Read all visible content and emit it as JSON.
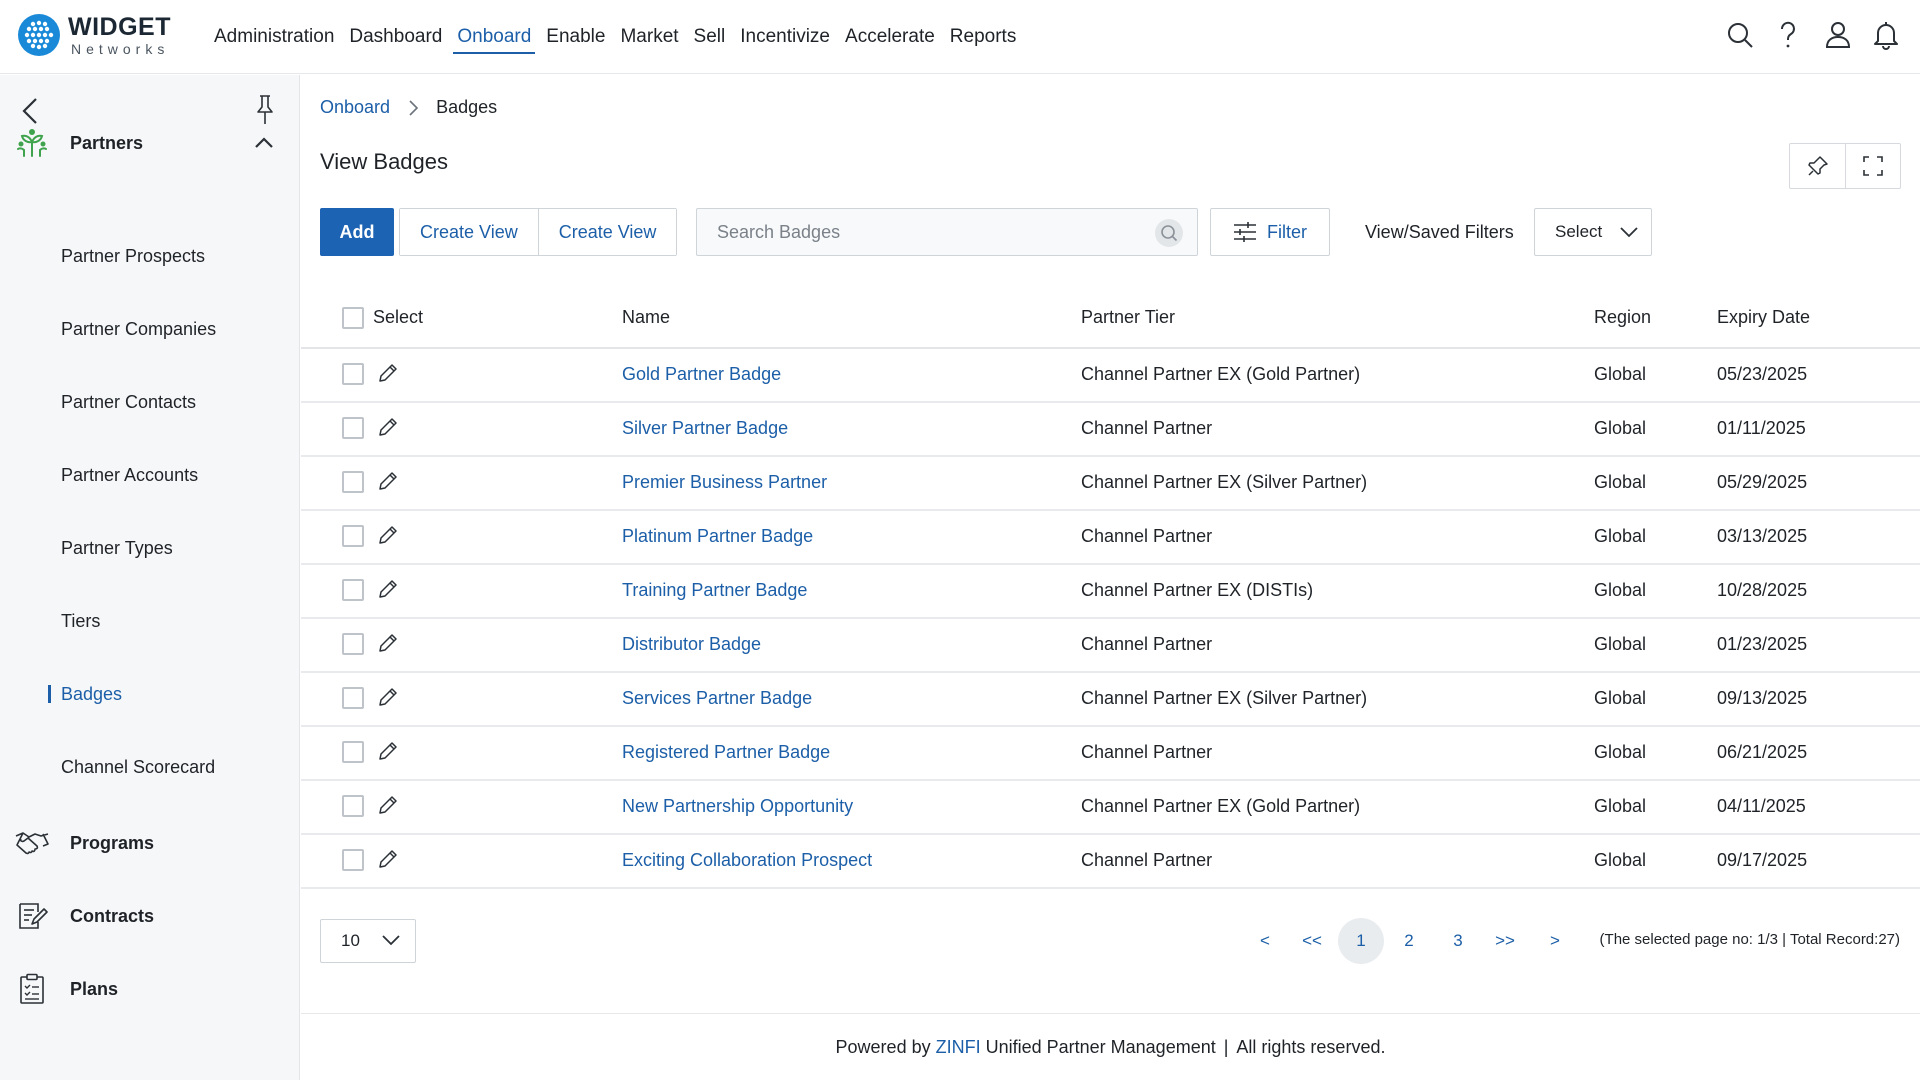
{
  "colors": {
    "accent": "#1c5fa8",
    "primary_button": "#1c63b4",
    "logo": "#1a8ad8",
    "sidebar_bg": "#f6f7f8",
    "partners_icon": "#3fa34d"
  },
  "brand": {
    "name": "WIDGET",
    "tagline": "Networks"
  },
  "nav": {
    "items": [
      "Administration",
      "Dashboard",
      "Onboard",
      "Enable",
      "Market",
      "Sell",
      "Incentivize",
      "Accelerate",
      "Reports"
    ],
    "active": "Onboard"
  },
  "top_icons": [
    "search-icon",
    "help-icon",
    "user-icon",
    "bell-icon"
  ],
  "sidebar": {
    "groups": [
      {
        "label": "Partners",
        "icon": "partners-icon",
        "expanded": true
      },
      {
        "label": "Programs",
        "icon": "handshake-icon"
      },
      {
        "label": "Contracts",
        "icon": "contract-icon"
      },
      {
        "label": "Plans",
        "icon": "clipboard-icon"
      }
    ],
    "partner_items": [
      "Partner Prospects",
      "Partner Companies",
      "Partner Contacts",
      "Partner Accounts",
      "Partner Types",
      "Tiers",
      "Badges",
      "Channel Scorecard"
    ],
    "active_item": "Badges"
  },
  "breadcrumb": {
    "parent": "Onboard",
    "current": "Badges"
  },
  "page": {
    "title": "View Badges"
  },
  "toolbar": {
    "add_label": "Add",
    "create_view_1": "Create View",
    "create_view_2": "Create View",
    "search_placeholder": "Search Badges",
    "search_value": "",
    "filter_label": "Filter",
    "saved_filters_label": "View/Saved Filters",
    "saved_filters_value": "Select"
  },
  "table": {
    "headers": {
      "select": "Select",
      "name": "Name",
      "tier": "Partner Tier",
      "region": "Region",
      "expiry": "Expiry Date"
    },
    "rows": [
      {
        "name": "Gold Partner Badge",
        "tier": "Channel Partner EX (Gold Partner)",
        "region": "Global",
        "expiry": "05/23/2025"
      },
      {
        "name": "Silver Partner Badge",
        "tier": "Channel Partner",
        "region": "Global",
        "expiry": "01/11/2025"
      },
      {
        "name": "Premier Business Partner",
        "tier": "Channel Partner EX (Silver Partner)",
        "region": "Global",
        "expiry": "05/29/2025"
      },
      {
        "name": "Platinum Partner Badge",
        "tier": "Channel Partner",
        "region": "Global",
        "expiry": "03/13/2025"
      },
      {
        "name": "Training Partner Badge",
        "tier": "Channel Partner EX (DISTIs)",
        "region": "Global",
        "expiry": "10/28/2025"
      },
      {
        "name": "Distributor Badge",
        "tier": "Channel Partner",
        "region": "Global",
        "expiry": "01/23/2025"
      },
      {
        "name": "Services Partner Badge",
        "tier": "Channel Partner EX (Silver Partner)",
        "region": "Global",
        "expiry": "09/13/2025"
      },
      {
        "name": "Registered Partner Badge",
        "tier": "Channel Partner",
        "region": "Global",
        "expiry": "06/21/2025"
      },
      {
        "name": "New Partnership Opportunity",
        "tier": "Channel Partner EX (Gold Partner)",
        "region": "Global",
        "expiry": "04/11/2025"
      },
      {
        "name": "Exciting Collaboration Prospect",
        "tier": "Channel Partner",
        "region": "Global",
        "expiry": "09/17/2025"
      }
    ]
  },
  "pagination": {
    "page_size": "10",
    "prev": "<",
    "first": "<<",
    "pages": [
      "1",
      "2",
      "3"
    ],
    "current_page": "1",
    "last": ">>",
    "next": ">",
    "info": "(The selected page no: 1/3 | Total Record:27)"
  },
  "footer": {
    "prefix": "Powered by",
    "brand": "ZINFI",
    "product": "Unified Partner Management",
    "separator": "|",
    "rights": "All rights reserved."
  }
}
